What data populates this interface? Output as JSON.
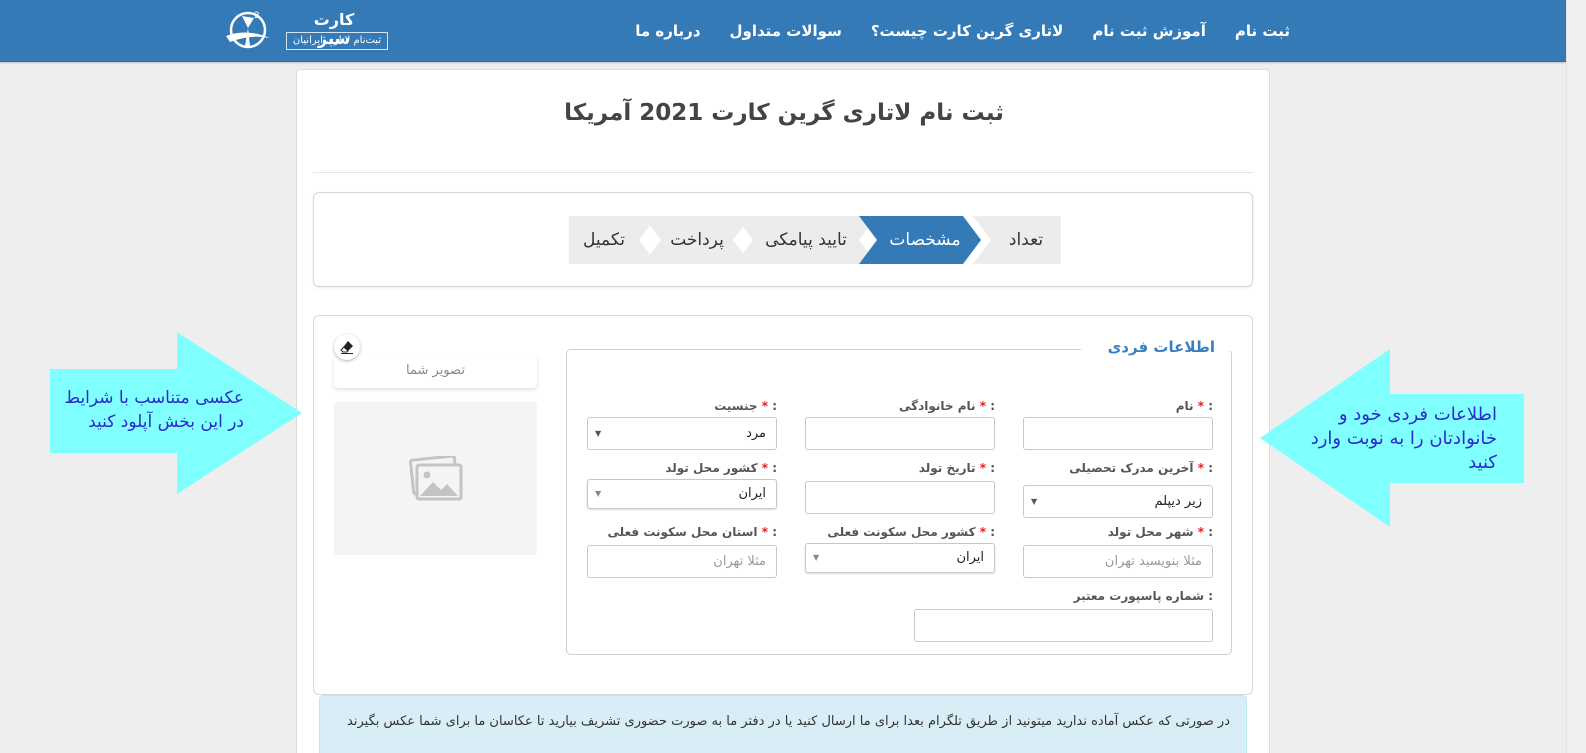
{
  "nav": {
    "links": [
      "ثبت نام",
      "آموزش ثبت نام",
      "لاتاری گرین کارت چیست؟",
      "سوالات متداول",
      "درباره ما"
    ],
    "brand_name": "کارت سبز",
    "brand_tagline": "ثبت‌نام لاتاری ایرانیان"
  },
  "page": {
    "title": "ثبت نام لاتاری گرین کارت 2021 آمریکا"
  },
  "steps": {
    "items": [
      "تعداد",
      "مشخصات",
      "تایید پیامکی",
      "پرداخت",
      "تکمیل"
    ],
    "active_index": 1
  },
  "form": {
    "legend": "اطلاعات فردی",
    "required_mark": "*",
    "labels": {
      "first_name": "نام",
      "last_name": "نام خانوادگی",
      "gender": "جنسیت",
      "education": "آخرین مدرک تحصیلی",
      "birth_date": "تاریخ تولد",
      "birth_country": "کشور محل تولد",
      "birth_city": "شهر محل تولد",
      "residence_country": "کشور محل سکونت فعلی",
      "residence_province": "استان محل سکونت فعلی",
      "passport": "شماره پاسپورت معتبر"
    },
    "label_suffix": " :",
    "values": {
      "first_name": "",
      "last_name": "",
      "gender": "مرد",
      "education": "زیر دیپلم",
      "birth_date": "",
      "birth_country": "ایران",
      "residence_country": "ایران",
      "passport": ""
    },
    "placeholders": {
      "birth_city": "مثلا بنویسید تهران",
      "residence_province": "مثلا تهران"
    }
  },
  "photo": {
    "title": "تصویر شما"
  },
  "alert": {
    "text": "در صورتی که عکس آماده ندارید میتونید از طریق تلگرام بعدا برای ما ارسال کنید یا در دفتر ما به صورت حضوری تشریف بیارید تا عکاسان ما برای شما عکس بگیرند"
  },
  "callouts": {
    "left_text": "عکسی متناسب با شرایط در این بخش آپلود کنید",
    "right_text": "اطلاعات فردی خود و خانوادتان را به نوبت وارد کنید"
  },
  "colors": {
    "primary": "#337ab7",
    "step_active": "#337ab7",
    "step_inactive": "#ececec",
    "callout": "#80ffff",
    "callout_text": "#2b2bcc",
    "required": "#e02020",
    "legend": "#3a7fc1",
    "alert_bg": "#d9edf7"
  },
  "icons": {
    "brand": "green-card-logo-icon",
    "eraser": "eraser-icon",
    "photo": "image-placeholder-icon",
    "caret": "caret-down-icon"
  }
}
